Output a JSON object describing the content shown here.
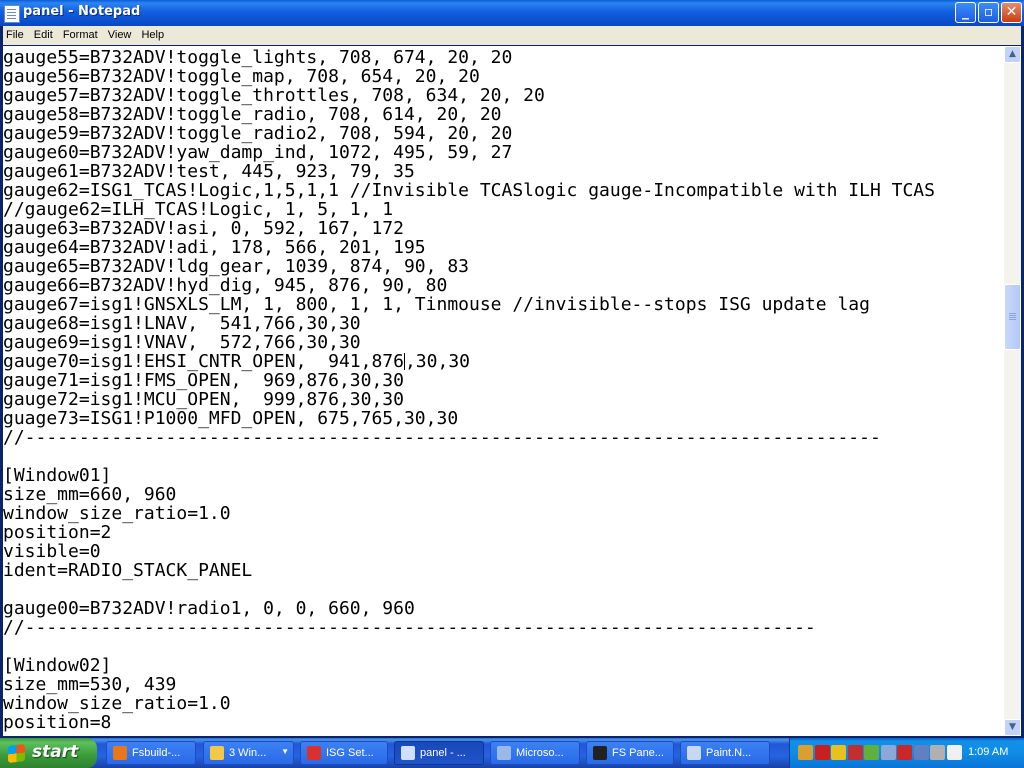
{
  "window": {
    "title": "panel - Notepad",
    "controls": {
      "minimize": "_",
      "maximize": "▫",
      "close": "✕"
    }
  },
  "menu": [
    "File",
    "Edit",
    "Format",
    "View",
    "Help"
  ],
  "editor": {
    "lines": [
      "gauge55=B732ADV!toggle_lights, 708, 674, 20, 20",
      "gauge56=B732ADV!toggle_map, 708, 654, 20, 20",
      "gauge57=B732ADV!toggle_throttles, 708, 634, 20, 20",
      "gauge58=B732ADV!toggle_radio, 708, 614, 20, 20",
      "gauge59=B732ADV!toggle_radio2, 708, 594, 20, 20",
      "gauge60=B732ADV!yaw_damp_ind, 1072, 495, 59, 27",
      "gauge61=B732ADV!test, 445, 923, 79, 35",
      "gauge62=ISG1_TCAS!Logic,1,5,1,1 //Invisible TCASlogic gauge-Incompatible with ILH TCAS",
      "//gauge62=ILH_TCAS!Logic, 1, 5, 1, 1",
      "gauge63=B732ADV!asi, 0, 592, 167, 172",
      "gauge64=B732ADV!adi, 178, 566, 201, 195",
      "gauge65=B732ADV!ldg_gear, 1039, 874, 90, 83",
      "gauge66=B732ADV!hyd_dig, 945, 876, 90, 80",
      "gauge67=isg1!GNSXLS_LM, 1, 800, 1, 1, Tinmouse //invisible--stops ISG update lag",
      "gauge68=isg1!LNAV,  541,766,30,30",
      "gauge69=isg1!VNAV,  572,766,30,30",
      "gauge70=isg1!EHSI_CNTR_OPEN,  941,876,30,30",
      "gauge71=isg1!FMS_OPEN,  969,876,30,30",
      "gauge72=isg1!MCU_OPEN,  999,876,30,30",
      "guage73=ISG1!P1000_MFD_OPEN, 675,765,30,30",
      "//-------------------------------------------------------------------------------",
      "",
      "[Window01]",
      "size_mm=660, 960",
      "window_size_ratio=1.0",
      "position=2",
      "visible=0",
      "ident=RADIO_STACK_PANEL",
      "",
      "gauge00=B732ADV!radio1, 0, 0, 660, 960",
      "//-------------------------------------------------------------------------",
      "",
      "[Window02]",
      "size_mm=530, 439",
      "window_size_ratio=1.0",
      "position=8"
    ]
  },
  "scrollbar": {
    "up": "▲",
    "down": "▼",
    "position": 0.36
  },
  "taskbar": {
    "start_label": "start",
    "tasks": [
      {
        "label": "Fsbuild-...",
        "icon_color": "#e8761c",
        "active": false
      },
      {
        "label": "3 Win...",
        "icon_color": "#f2c84a",
        "active": false,
        "group": true
      },
      {
        "label": "ISG Set...",
        "icon_color": "#d93030",
        "active": false
      },
      {
        "label": "panel - ...",
        "icon_color": "#cfe0ff",
        "active": true
      },
      {
        "label": "Microso...",
        "icon_color": "#9ab8e8",
        "active": false
      },
      {
        "label": "FS Pane...",
        "icon_color": "#222222",
        "active": false
      },
      {
        "label": "Paint.N...",
        "icon_color": "#c8d8f0",
        "active": false
      }
    ],
    "tray": {
      "icons": [
        "antivirus-icon",
        "pdf-icon",
        "warning-icon",
        "security-icon",
        "nvidia-icon",
        "network-icon",
        "shield-icon",
        "monitor-icon",
        "audio-icon",
        "m-icon"
      ],
      "clock": "1:09 AM"
    }
  }
}
